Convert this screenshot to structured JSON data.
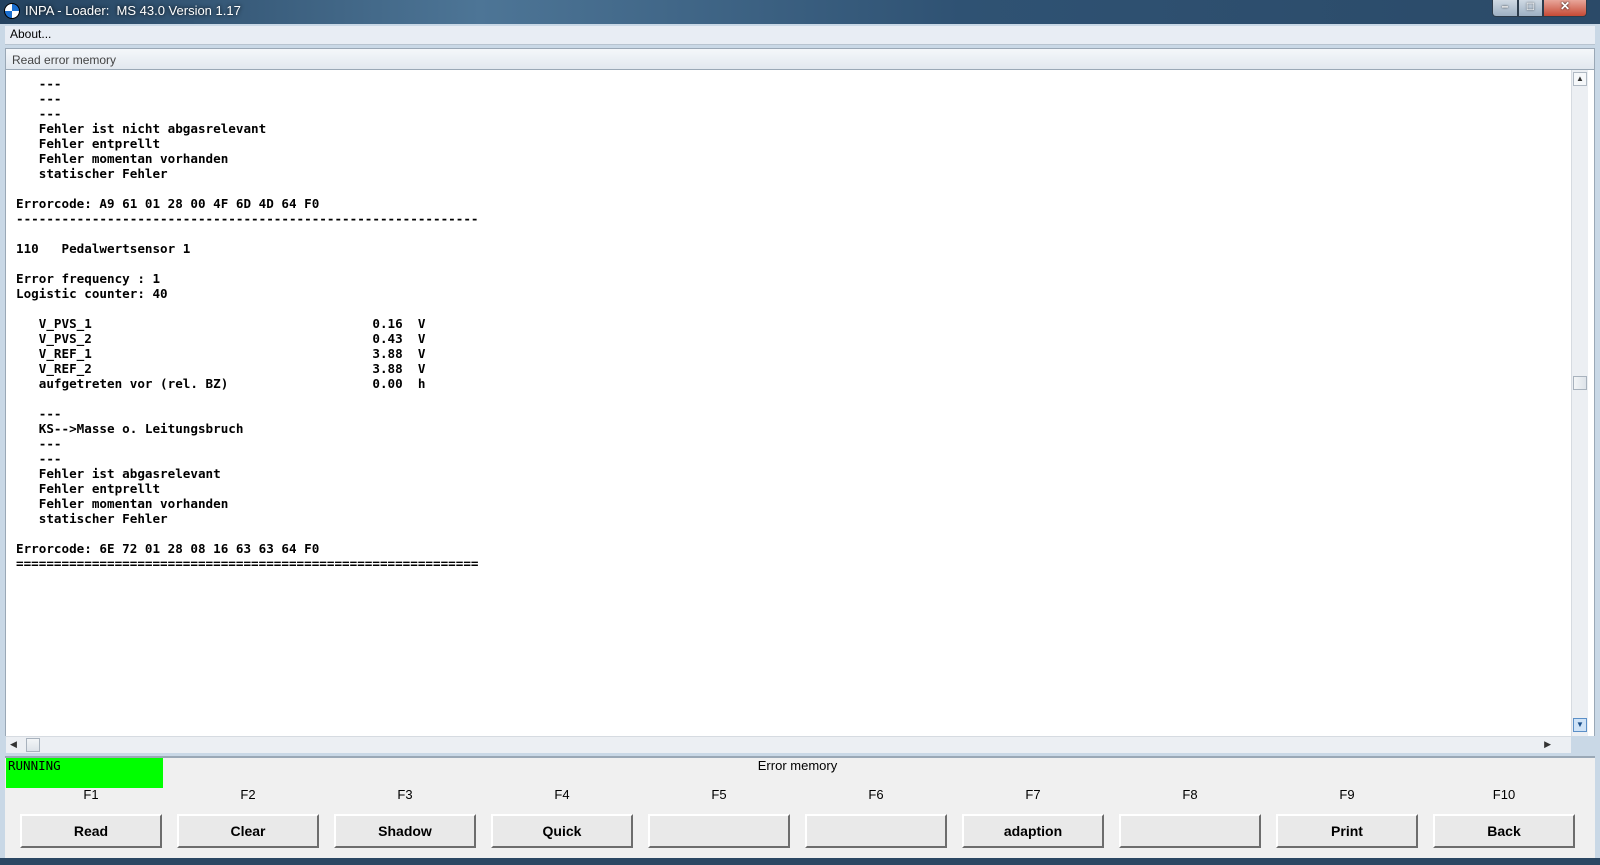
{
  "window": {
    "title": "INPA - Loader:  MS 43.0 Version 1.17",
    "minimize_glyph": "–",
    "maximize_glyph": "□",
    "close_glyph": "✕"
  },
  "menu": {
    "about": "About..."
  },
  "panel": {
    "title": "Read error memory"
  },
  "log_text": "   ---\n   ---\n   ---\n   Fehler ist nicht abgasrelevant\n   Fehler entprellt\n   Fehler momentan vorhanden\n   statischer Fehler\n\nErrorcode: A9 61 01 28 00 4F 6D 4D 64 F0\n-------------------------------------------------------------\n\n110   Pedalwertsensor 1\n\nError frequency : 1\nLogistic counter: 40\n\n   V_PVS_1                                     0.16  V\n   V_PVS_2                                     0.43  V\n   V_REF_1                                     3.88  V\n   V_REF_2                                     3.88  V\n   aufgetreten vor (rel. BZ)                   0.00  h\n\n   ---\n   KS-->Masse o. Leitungsbruch\n   ---\n   ---\n   Fehler ist abgasrelevant\n   Fehler entprellt\n   Fehler momentan vorhanden\n   statischer Fehler\n\nErrorcode: 6E 72 01 28 08 16 63 63 64 F0\n=============================================================",
  "status": {
    "state": "RUNNING",
    "screen_title": "Error memory",
    "state_color": "#00ff00"
  },
  "fkeys": [
    {
      "key": "F1",
      "label": "Read"
    },
    {
      "key": "F2",
      "label": "Clear"
    },
    {
      "key": "F3",
      "label": "Shadow"
    },
    {
      "key": "F4",
      "label": "Quick"
    },
    {
      "key": "F5",
      "label": ""
    },
    {
      "key": "F6",
      "label": ""
    },
    {
      "key": "F7",
      "label": "adaption"
    },
    {
      "key": "F8",
      "label": ""
    },
    {
      "key": "F9",
      "label": "Print"
    },
    {
      "key": "F10",
      "label": "Back"
    }
  ],
  "scroll": {
    "up_arrow": "▲",
    "down_arrow": "▼",
    "left_arrow": "◀",
    "right_arrow": "▶"
  }
}
